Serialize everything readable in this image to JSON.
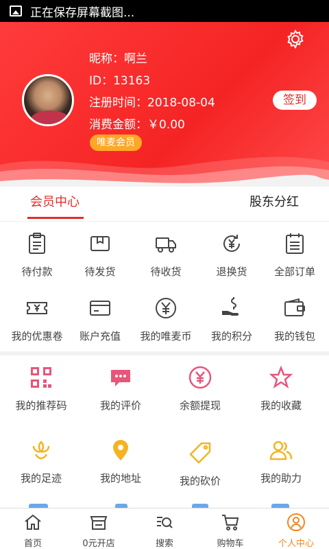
{
  "status_bar": {
    "text": "正在保存屏幕截图..."
  },
  "profile": {
    "nickname": "昵称：啊兰",
    "id": "ID：13163",
    "register_date": "注册时间：2018-08-04",
    "spending": "消费金额：￥0.00",
    "vip_badge": "唯麦会员",
    "signin_label": "签到"
  },
  "tabs": [
    {
      "label": "会员中心",
      "active": true
    },
    {
      "label": "股东分红",
      "active": false
    }
  ],
  "orders": [
    {
      "label": "待付款",
      "icon": "clipboard-icon"
    },
    {
      "label": "待发货",
      "icon": "package-icon"
    },
    {
      "label": "待收货",
      "icon": "truck-icon"
    },
    {
      "label": "退换货",
      "icon": "yuan-refresh-icon"
    },
    {
      "label": "全部订单",
      "icon": "calendar-list-icon"
    }
  ],
  "account": [
    {
      "label": "我的优惠卷",
      "icon": "coupon-icon"
    },
    {
      "label": "账户充值",
      "icon": "card-icon"
    },
    {
      "label": "我的唯麦币",
      "icon": "yuan-coin-icon"
    },
    {
      "label": "我的积分",
      "icon": "hand-coin-icon"
    },
    {
      "label": "我的钱包",
      "icon": "wallet-icon"
    }
  ],
  "features": [
    {
      "label": "我的推荐码",
      "icon": "qrcode-icon",
      "color": "#e8557a"
    },
    {
      "label": "我的评价",
      "icon": "chat-icon",
      "color": "#e8557a"
    },
    {
      "label": "余额提现",
      "icon": "yuan-circle-icon",
      "color": "#e8557a"
    },
    {
      "label": "我的收藏",
      "icon": "star-icon",
      "color": "#e8557a"
    },
    {
      "label": "我的足迹",
      "icon": "flower-icon",
      "color": "#f5b324"
    },
    {
      "label": "我的地址",
      "icon": "location-pin-icon",
      "color": "#f5b324"
    },
    {
      "label": "我的砍价",
      "icon": "tag-icon",
      "color": "#f5b324"
    },
    {
      "label": "我的助力",
      "icon": "people-icon",
      "color": "#f5b324"
    }
  ],
  "bottom_nav": [
    {
      "label": "首页",
      "icon": "home-icon",
      "active": false
    },
    {
      "label": "0元开店",
      "icon": "store-icon",
      "active": false
    },
    {
      "label": "搜索",
      "icon": "search-list-icon",
      "active": false
    },
    {
      "label": "购物车",
      "icon": "cart-icon",
      "active": false
    },
    {
      "label": "个人中心",
      "icon": "user-circle-icon",
      "active": true
    }
  ],
  "colors": {
    "brand_red": "#e32b2b",
    "accent_orange": "#f5861f",
    "badge_orange": "#ffa726",
    "pink": "#e8557a",
    "yellow": "#f5b324"
  }
}
